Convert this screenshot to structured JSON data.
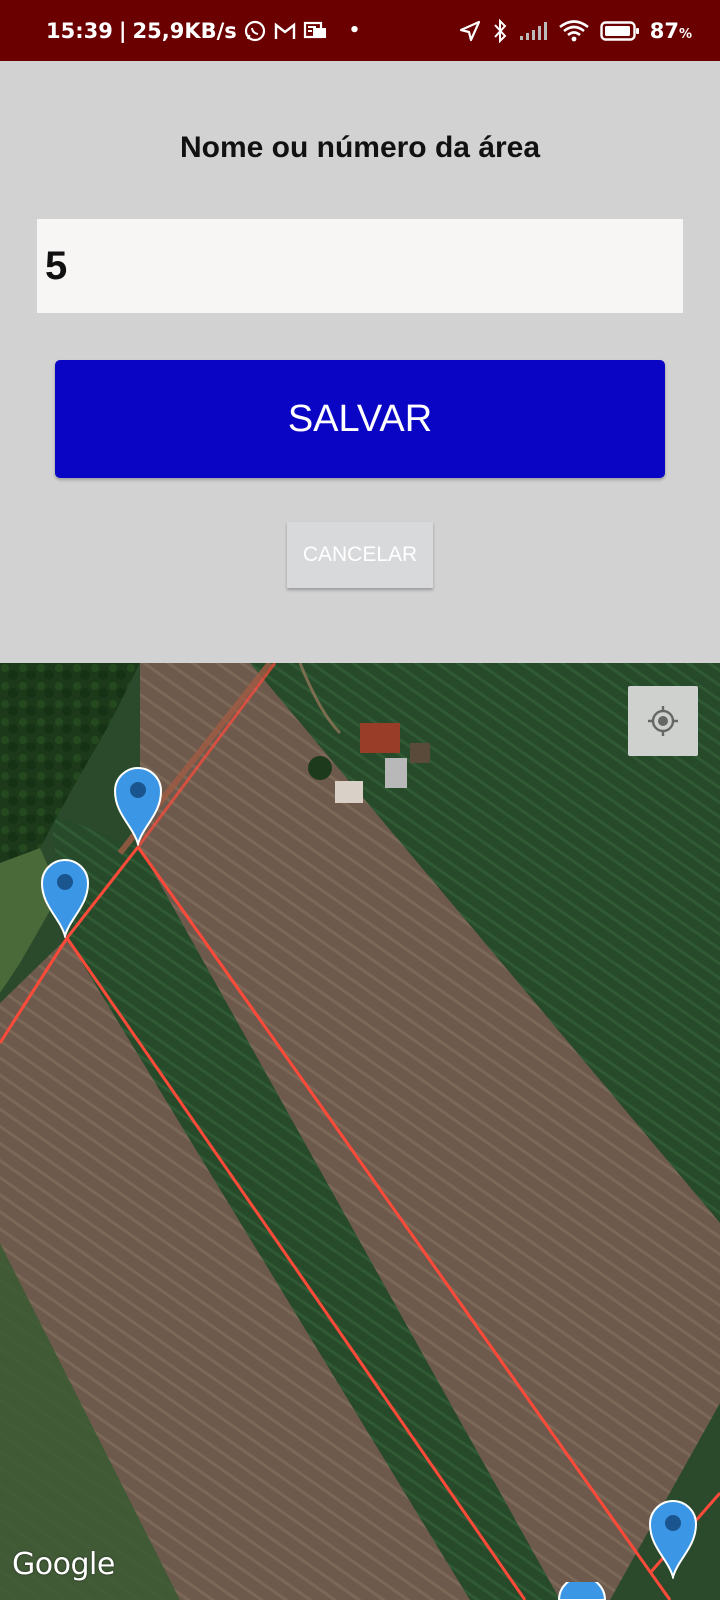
{
  "status_bar": {
    "time": "15:39",
    "separator": "|",
    "speed": "25,9KB/s",
    "dot": "•",
    "battery_value": "87",
    "battery_unit": "%",
    "background": "#6b0000",
    "left_icons": [
      "whatsapp-icon",
      "gmail-icon",
      "notification-icon"
    ],
    "right_icons": [
      "location-arrow-icon",
      "bluetooth-icon",
      "signal-icon",
      "wifi-icon",
      "battery-icon"
    ]
  },
  "form": {
    "title": "Nome ou número da área",
    "input_value": "5",
    "save_label": "SALVAR",
    "cancel_label": "CANCELAR",
    "save_color": "#0a05c5"
  },
  "map": {
    "type": "satellite",
    "boundary_color": "#ff4a3a",
    "marker_color": "#3b97e6",
    "locate_icon": "my-location-icon",
    "attribution": "Google"
  }
}
